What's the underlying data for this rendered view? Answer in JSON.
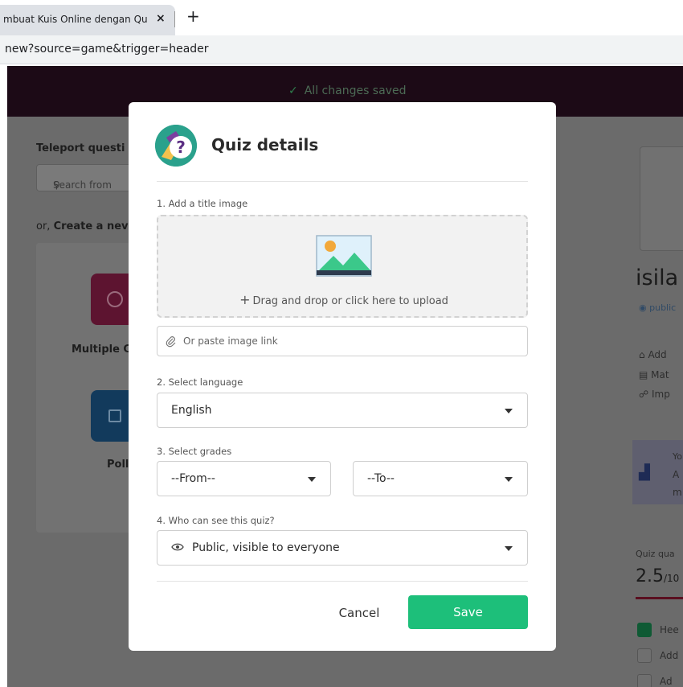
{
  "browser": {
    "tab_title": "mbuat Kuis Online dengan Qu",
    "tab_close": "×",
    "new_tab": "+",
    "url": "new?source=game&trigger=header"
  },
  "app": {
    "save_status": "All changes saved",
    "teleport_heading": "Teleport questi",
    "search_placeholder": "Search from",
    "create_prefix": "or,",
    "create_label": "Create a nev",
    "question_types": [
      "Multiple C",
      "Poll"
    ],
    "right_title": "isila",
    "right_visibility": "public",
    "right_lines": [
      "Add",
      "Mat",
      "Imp"
    ],
    "right_banner": [
      "Yo",
      "A",
      "m"
    ],
    "quiz_quality_label": "Quiz qua",
    "quiz_quality_score": "2.5",
    "quiz_quality_suffix": "/10",
    "checklist": [
      "Hee",
      "Add",
      "Ad"
    ]
  },
  "modal": {
    "title": "Quiz details",
    "title_image_label": "1. Add a title image",
    "upload_text": "Drag and drop or click here to upload",
    "image_link_placeholder": "Or paste image link",
    "language_label": "2. Select language",
    "language_value": "English",
    "grades_label": "3. Select grades",
    "grade_from": "--From--",
    "grade_to": "--To--",
    "visibility_label": "4. Who can see this quiz?",
    "visibility_value": "Public, visible to everyone",
    "cancel_label": "Cancel",
    "save_label": "Save"
  },
  "colors": {
    "accent_green": "#1dbf7a",
    "topbar": "#1c0a16",
    "overlay": "#6b6b6b"
  },
  "icons": {
    "upload": "image-placeholder-icon",
    "link": "paperclip-icon",
    "visibility": "eye-icon",
    "dropdown": "caret-down-icon",
    "logo": "quiz-question-mark-icon"
  }
}
